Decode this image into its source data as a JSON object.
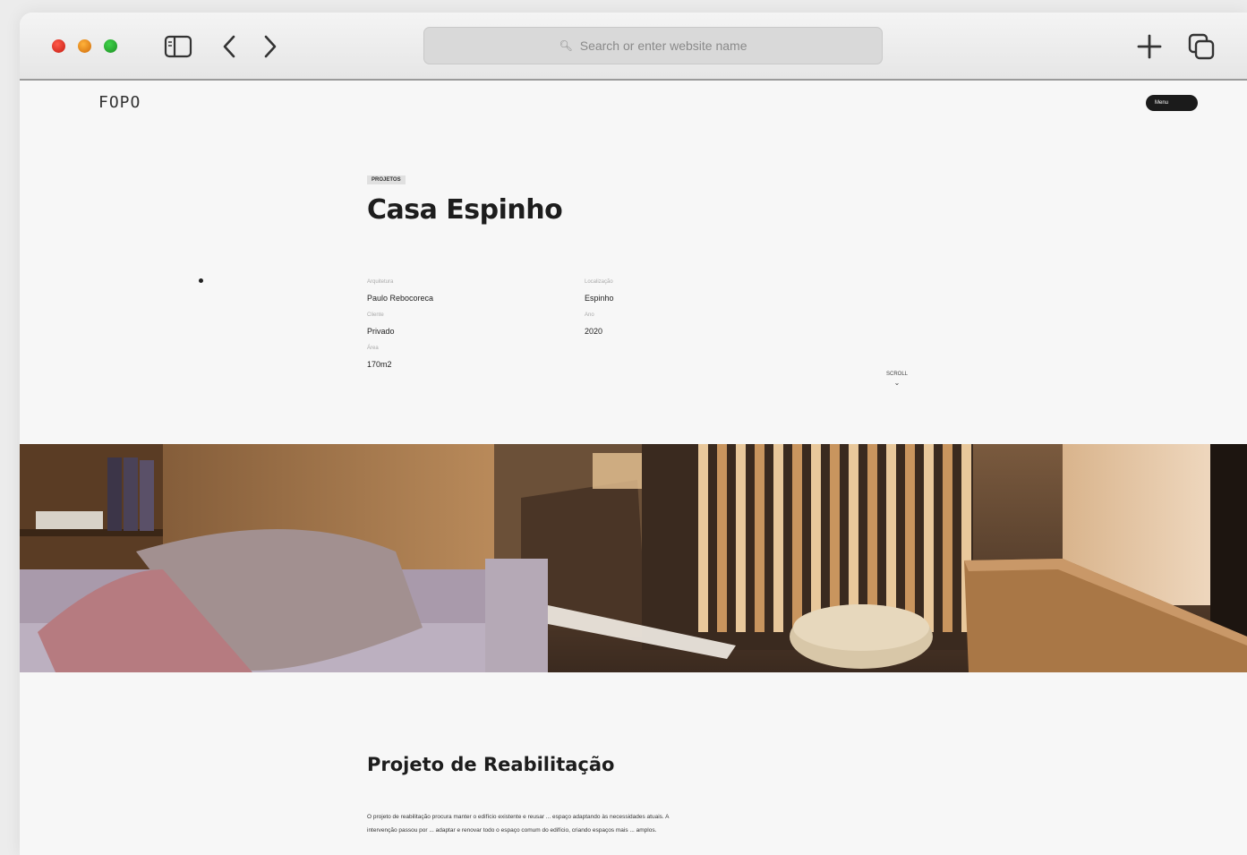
{
  "browser": {
    "url_placeholder": "Search or enter website name",
    "icons": {
      "search": "magnifier-icon",
      "sidebar": "sidebar-icon",
      "back": "chevron-left-icon",
      "forward": "chevron-right-icon",
      "new_tab": "plus-icon",
      "tabs": "tab-overview-icon"
    }
  },
  "site": {
    "logo": "FOPO",
    "menu_label": "Menu",
    "badge": "PROJETOS",
    "title": "Casa Espinho",
    "meta": [
      {
        "label": "Arquitetura",
        "value": "Paulo Rebocoreca"
      },
      {
        "label": "Localização",
        "value": "Espinho"
      },
      {
        "label": "Cliente",
        "value": "Privado"
      },
      {
        "label": "Ano",
        "value": "2020"
      },
      {
        "label": "Área",
        "value": "170m2"
      }
    ],
    "scroll_label": "SCROLL",
    "scroll_icon": "chevron-down-icon",
    "section_title": "Projeto de Reabilitação",
    "body": "O projeto de reabilitação procura manter o edifício existente e reusar ... espaço adaptando às necessidades atuais. A intervenção passou por ... adaptar e renovar todo o espaço comum do edifício, criando espaços mais ... amplos."
  },
  "colors": {
    "accent_dark": "#1b1b1b",
    "wood": "#b07a45",
    "sofa": "#b5a9b6"
  }
}
